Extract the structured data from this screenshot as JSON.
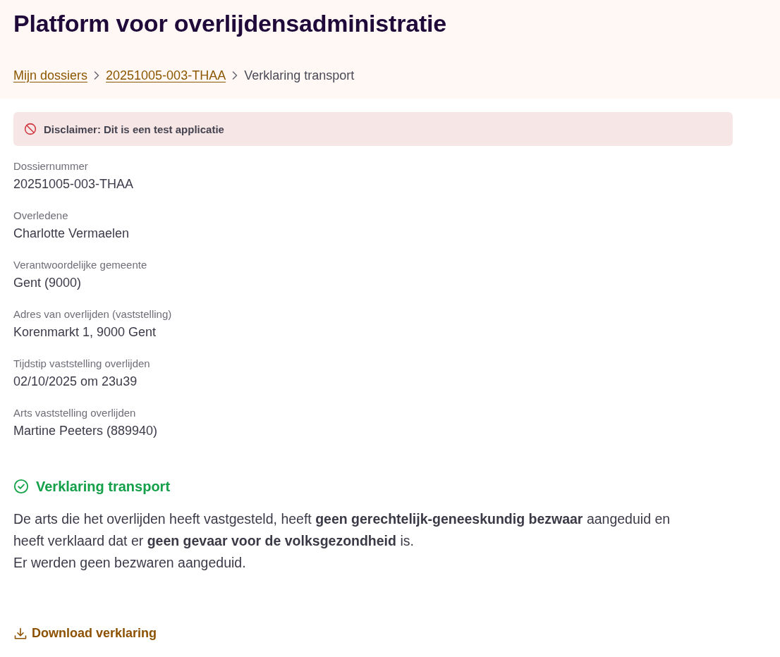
{
  "header": {
    "title": "Platform voor overlijdensadministratie",
    "breadcrumb": [
      {
        "label": "Mijn dossiers",
        "kind": "link"
      },
      {
        "label": "20251005-003-THAA",
        "kind": "link"
      },
      {
        "label": "Verklaring transport",
        "kind": "current"
      }
    ]
  },
  "disclaimer": {
    "text": "Disclaimer: Dit is een test applicatie"
  },
  "fields": [
    {
      "label": "Dossiernummer",
      "value": "20251005-003-THAA"
    },
    {
      "label": "Overledene",
      "value": "Charlotte Vermaelen"
    },
    {
      "label": "Verantwoordelijke gemeente",
      "value": "Gent (9000)"
    },
    {
      "label": "Adres van overlijden (vaststelling)",
      "value": "Korenmarkt 1, 9000 Gent"
    },
    {
      "label": "Tijdstip vaststelling overlijden",
      "value": "02/10/2025 om 23u39"
    },
    {
      "label": "Arts vaststelling overlijden",
      "value": "Martine Peeters (889940)"
    }
  ],
  "section": {
    "title": "Verklaring transport",
    "paragraphs": [
      "De arts die het overlijden heeft vastgesteld, heeft **geen gerechtelijk-geneeskundig bezwaar** aangeduid en heeft verklaard dat er **geen gevaar voor de volksgezondheid** is.",
      "Er werden geen bezwaren aangeduid."
    ]
  },
  "download": {
    "label": "Download verklaring"
  }
}
